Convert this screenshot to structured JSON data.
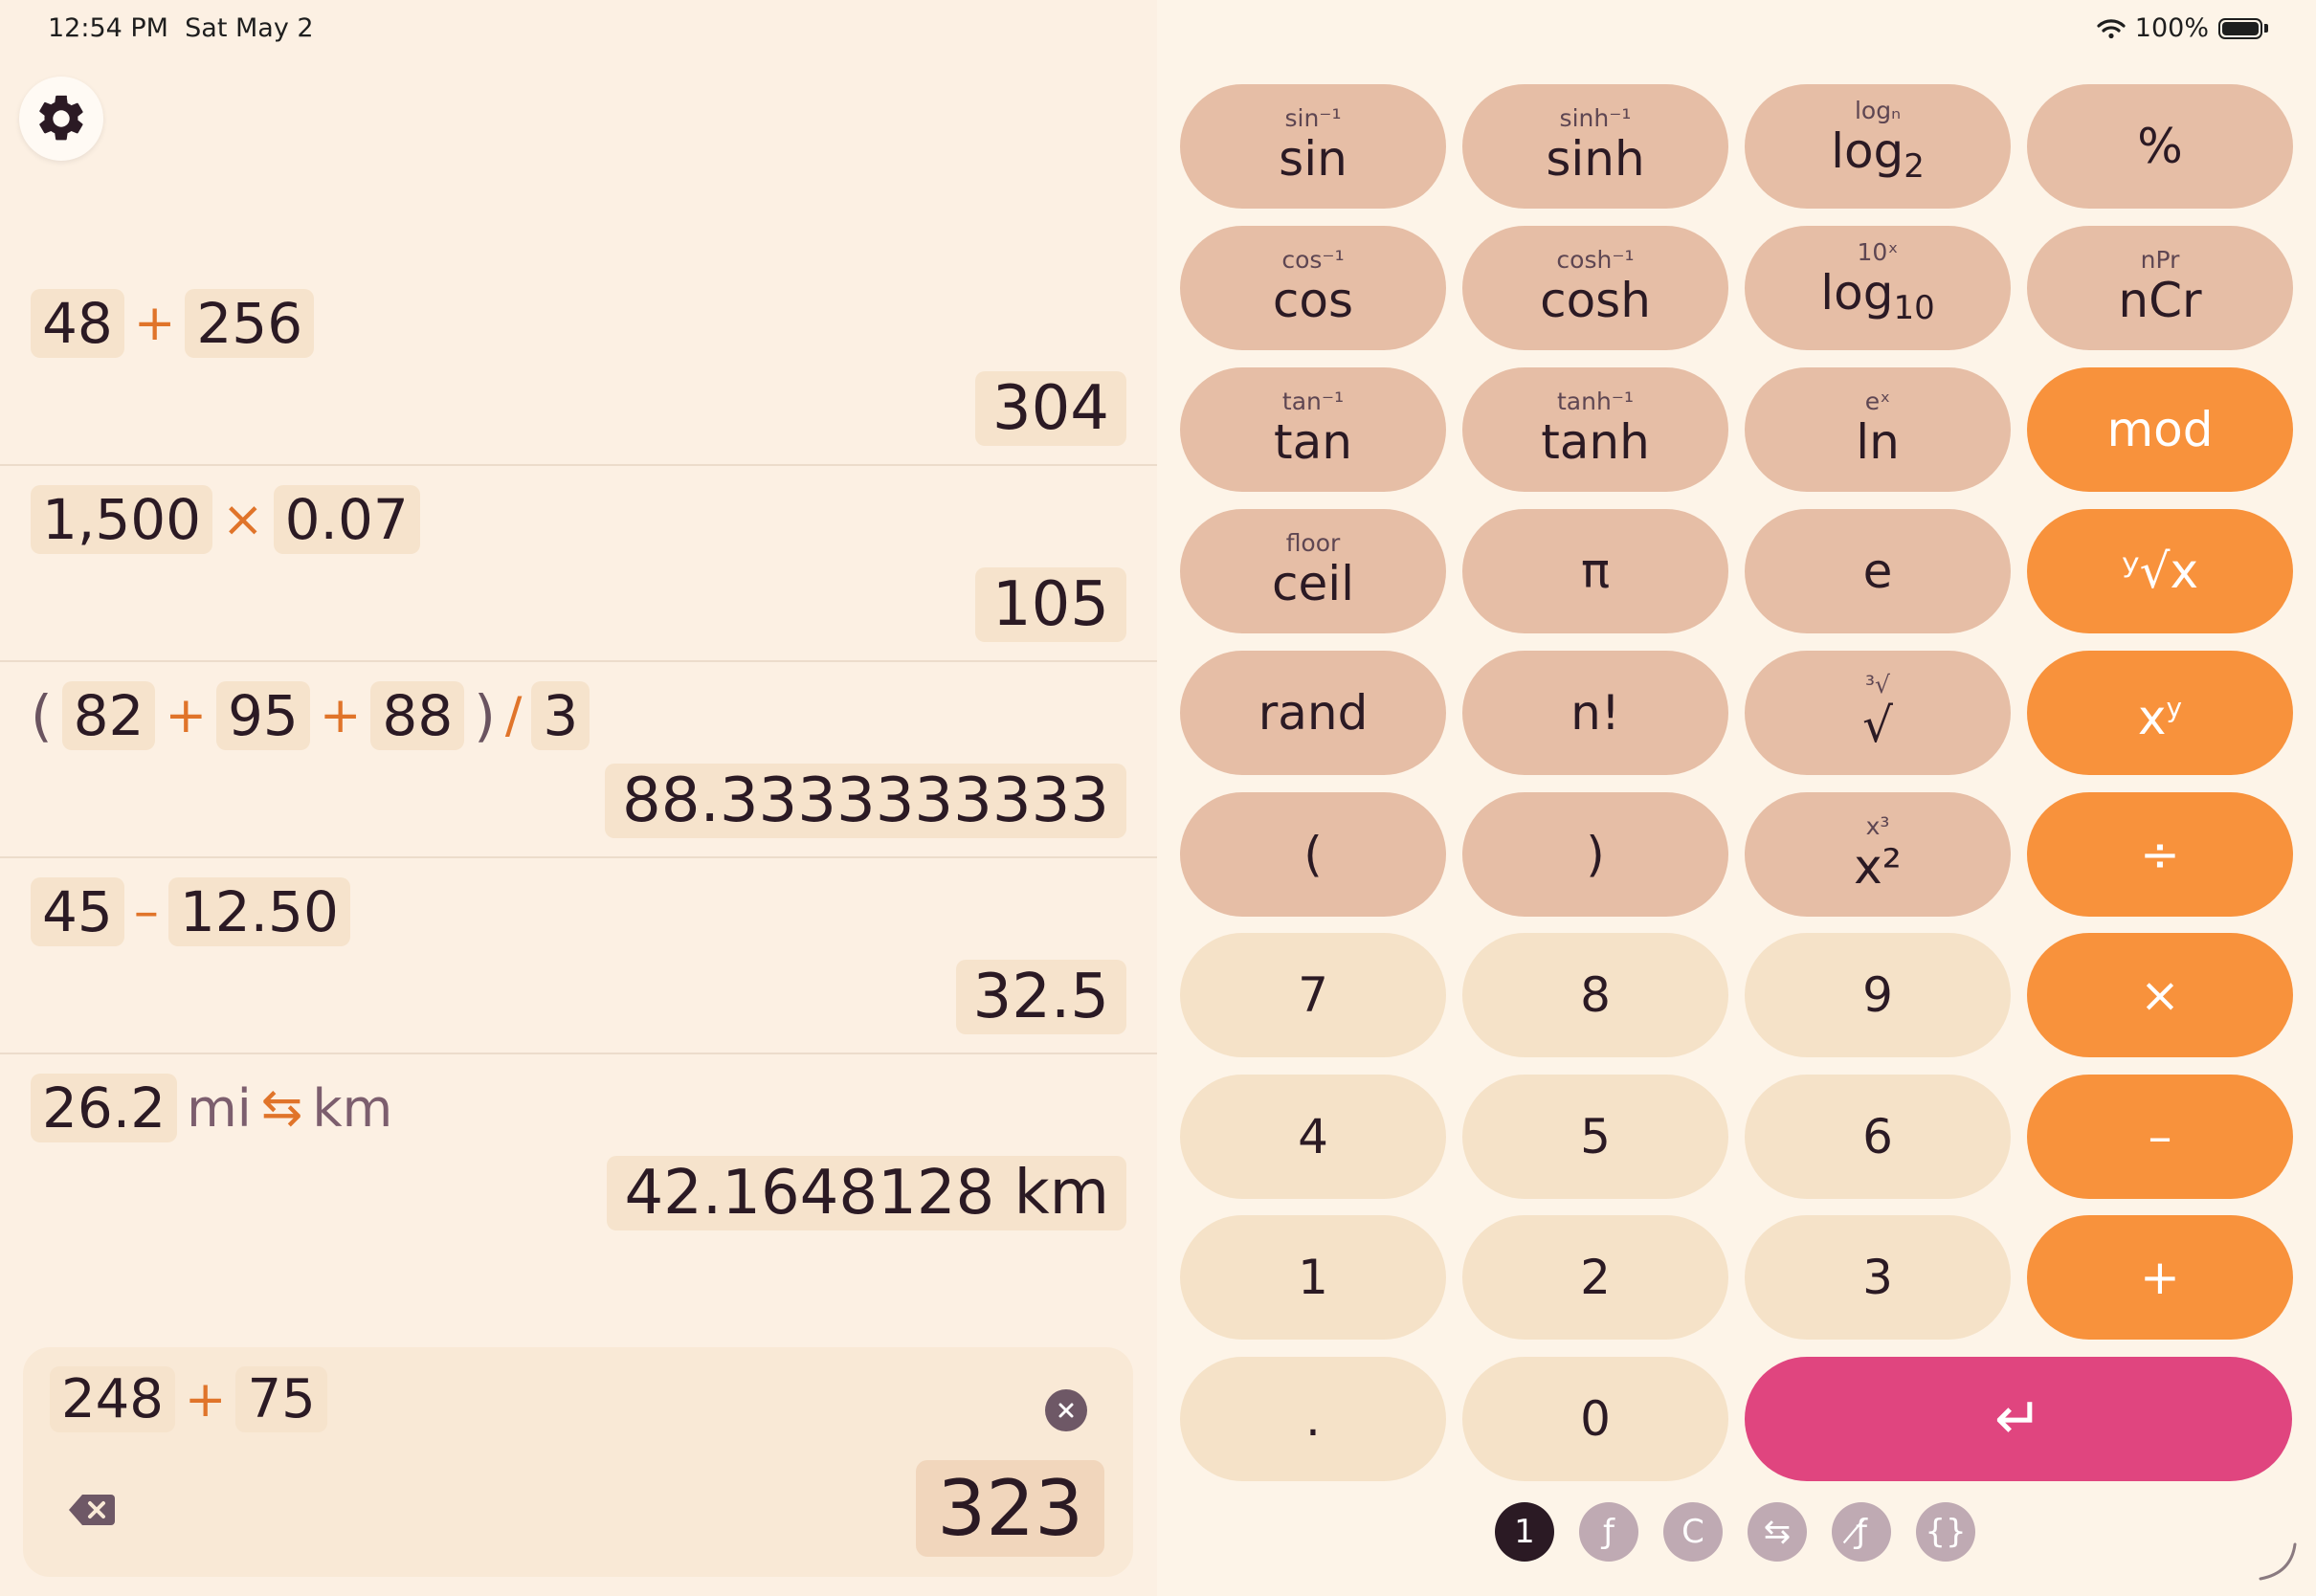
{
  "status": {
    "time": "12:54 PM",
    "date": "Sat May 2",
    "battery": "100%"
  },
  "history": [
    {
      "tokens": [
        {
          "t": "num",
          "v": "48"
        },
        {
          "t": "op",
          "v": "+"
        },
        {
          "t": "num",
          "v": "256"
        }
      ],
      "result": "304"
    },
    {
      "tokens": [
        {
          "t": "num",
          "v": "1,500"
        },
        {
          "t": "op",
          "v": "×"
        },
        {
          "t": "num",
          "v": "0.07"
        }
      ],
      "result": "105"
    },
    {
      "tokens": [
        {
          "t": "paren",
          "v": "("
        },
        {
          "t": "num",
          "v": "82"
        },
        {
          "t": "op",
          "v": "+"
        },
        {
          "t": "num",
          "v": "95"
        },
        {
          "t": "op",
          "v": "+"
        },
        {
          "t": "num",
          "v": "88"
        },
        {
          "t": "paren",
          "v": ")"
        },
        {
          "t": "op",
          "v": "/"
        },
        {
          "t": "num",
          "v": "3"
        }
      ],
      "result": "88.3333333333"
    },
    {
      "tokens": [
        {
          "t": "num",
          "v": "45"
        },
        {
          "t": "op",
          "v": "–"
        },
        {
          "t": "num",
          "v": "12.50"
        }
      ],
      "result": "32.5"
    },
    {
      "tokens": [
        {
          "t": "num",
          "v": "26.2"
        },
        {
          "t": "unit",
          "v": "mi"
        },
        {
          "t": "op",
          "v": "⇆"
        },
        {
          "t": "unit",
          "v": "km"
        }
      ],
      "result": "42.1648128 km"
    }
  ],
  "current": {
    "left": "248",
    "op": "+",
    "right": "75",
    "result": "323"
  },
  "keys": [
    {
      "sub": "sin⁻¹",
      "main": "sin",
      "style": "fn"
    },
    {
      "sub": "sinh⁻¹",
      "main": "sinh",
      "style": "fn"
    },
    {
      "sub": "logₙ",
      "main": "log",
      "main_sub": "2",
      "style": "fn"
    },
    {
      "sub": "",
      "main": "%",
      "style": "fn"
    },
    {
      "sub": "cos⁻¹",
      "main": "cos",
      "style": "fn"
    },
    {
      "sub": "cosh⁻¹",
      "main": "cosh",
      "style": "fn"
    },
    {
      "sub": "10ˣ",
      "main": "log",
      "main_sub": "10",
      "style": "fn"
    },
    {
      "sub": "nPr",
      "main": "nCr",
      "style": "fn"
    },
    {
      "sub": "tan⁻¹",
      "main": "tan",
      "style": "fn"
    },
    {
      "sub": "tanh⁻¹",
      "main": "tanh",
      "style": "fn"
    },
    {
      "sub": "eˣ",
      "main": "ln",
      "style": "fn"
    },
    {
      "sub": "",
      "main": "mod",
      "style": "op"
    },
    {
      "sub": "floor",
      "main": "ceil",
      "style": "fn"
    },
    {
      "sub": "",
      "main": "π",
      "style": "fn"
    },
    {
      "sub": "",
      "main": "e",
      "style": "fn"
    },
    {
      "sub": "",
      "main": "ʸ√x",
      "style": "op"
    },
    {
      "sub": "",
      "main": "rand",
      "style": "fn"
    },
    {
      "sub": "",
      "main": "n!",
      "style": "fn"
    },
    {
      "sub": "³√",
      "main": "√",
      "style": "fn"
    },
    {
      "sub": "",
      "main": "x",
      "main_sup": "y",
      "style": "op"
    },
    {
      "sub": "",
      "main": "(",
      "style": "fn"
    },
    {
      "sub": "",
      "main": ")",
      "style": "fn"
    },
    {
      "sub": "x³",
      "main": "x²",
      "style": "fn"
    },
    {
      "sub": "",
      "main": "÷",
      "style": "op"
    },
    {
      "sub": "",
      "main": "7",
      "style": "num"
    },
    {
      "sub": "",
      "main": "8",
      "style": "num"
    },
    {
      "sub": "",
      "main": "9",
      "style": "num"
    },
    {
      "sub": "",
      "main": "×",
      "style": "op"
    },
    {
      "sub": "",
      "main": "4",
      "style": "num"
    },
    {
      "sub": "",
      "main": "5",
      "style": "num"
    },
    {
      "sub": "",
      "main": "6",
      "style": "num"
    },
    {
      "sub": "",
      "main": "–",
      "style": "op"
    },
    {
      "sub": "",
      "main": "1",
      "style": "num"
    },
    {
      "sub": "",
      "main": "2",
      "style": "num"
    },
    {
      "sub": "",
      "main": "3",
      "style": "num"
    },
    {
      "sub": "",
      "main": "+",
      "style": "op"
    },
    {
      "sub": "",
      "main": ".",
      "style": "num"
    },
    {
      "sub": "",
      "main": "0",
      "style": "num"
    }
  ],
  "enter_label": "↵",
  "modes": [
    {
      "label": "1",
      "active": true
    },
    {
      "label": "ƒ",
      "active": false
    },
    {
      "label": "C",
      "active": false
    },
    {
      "label": "⇆",
      "active": false
    },
    {
      "label": "ƒ̸",
      "active": false
    },
    {
      "label": "{}",
      "active": false
    }
  ],
  "colors": {
    "accent_op": "#f8923c",
    "enter": "#e0457f",
    "fn_key": "#e6bea6",
    "num_key": "#f5e2c8"
  }
}
